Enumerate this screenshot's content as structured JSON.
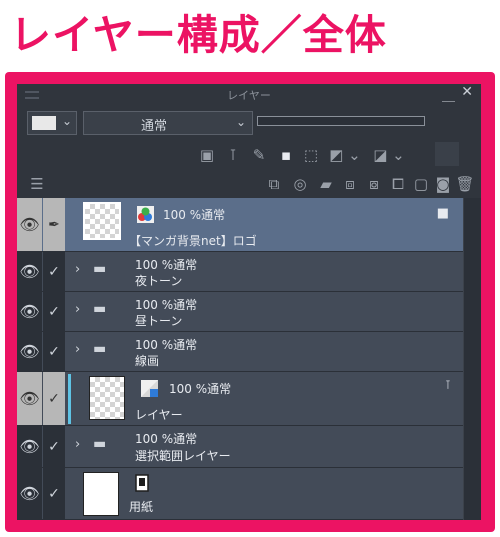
{
  "heading": "レイヤー構成／全体",
  "panel": {
    "title": "レイヤー",
    "minimize": "＿",
    "close": "✕",
    "blend_mode": "通常",
    "color_dropdown": "⌄",
    "blend_dropdown": "⌄"
  },
  "layers": [
    {
      "name": "【マンガ背景net】ロゴ",
      "opacity_mode": "100 %通常",
      "kind": "raster-logo",
      "selected": true,
      "locked": true
    },
    {
      "name": "夜トーン",
      "opacity_mode": "100 %通常",
      "kind": "folder"
    },
    {
      "name": "昼トーン",
      "opacity_mode": "100 %通常",
      "kind": "folder"
    },
    {
      "name": "線画",
      "opacity_mode": "100 %通常",
      "kind": "folder"
    },
    {
      "name": "レイヤー",
      "opacity_mode": "100 %通常",
      "kind": "raster"
    },
    {
      "name": "選択範囲レイヤー",
      "opacity_mode": "100 %通常",
      "kind": "folder"
    },
    {
      "name": "用紙",
      "opacity_mode": "",
      "kind": "paper"
    }
  ],
  "glyphs": {
    "eye": "👁",
    "check": "✓",
    "pen": "✒",
    "arrow": "›",
    "folder": "▬",
    "lock": "🔒"
  },
  "colors": {
    "accent": "#ec1363",
    "panel_bg": "#2b3038",
    "layer_bg": "#434b58",
    "selected_bg": "#5b6e8a"
  }
}
